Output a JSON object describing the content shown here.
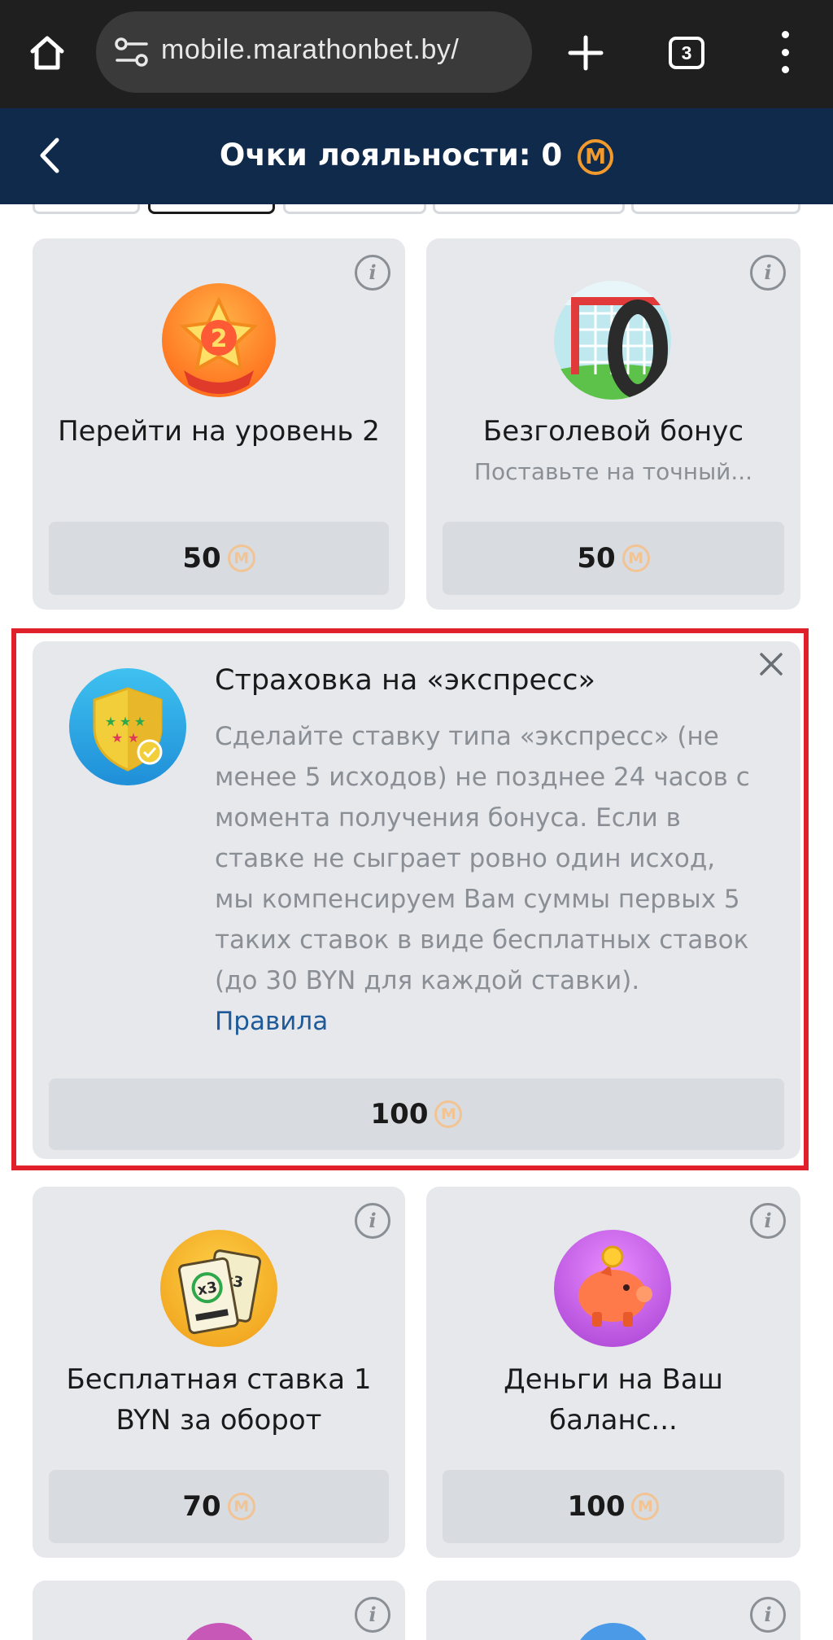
{
  "browser": {
    "url": "mobile.marathonbet.by/",
    "tab_count": "3"
  },
  "header": {
    "title": "Очки лояльности: 0",
    "coin_symbol": "М"
  },
  "coin_symbol": "М",
  "offers": [
    {
      "title": "Перейти на уровень 2",
      "subtitle": "",
      "price": "50",
      "icon": "level-2-star-medal-icon"
    },
    {
      "title": "Безголевой бонус",
      "subtitle": "Поставьте на точный...",
      "price": "50",
      "icon": "goal-zero-icon"
    }
  ],
  "featured": {
    "title": "Страховка на «экспресс»",
    "description": "Сделайте ставку типа «экспресс» (не менее 5 исходов) не позднее 24 часов с момента получения бонуса. Если в ставке не сыграет ровно один исход, мы компенсируем Вам суммы первых 5 таких ставок в виде бесплатных ставок (до 30 BYN для каждой ставки).",
    "rules_link": "Правила",
    "price": "100",
    "icon": "shield-stars-icon"
  },
  "offers_bottom": [
    {
      "title": "Бесплатная ставка 1 BYN за оборот",
      "price": "70",
      "icon": "free-bet-x3-icon"
    },
    {
      "title": "Деньги на Ваш баланс...",
      "price": "100",
      "icon": "piggy-bank-icon"
    }
  ],
  "colors": {
    "browser_bar": "#1f1f1f",
    "header_bg": "#0f2a4a",
    "card_bg": "#e6e8ec",
    "highlight_border": "#e0202a",
    "coin": "#f29a2e",
    "link": "#1e5a9a"
  }
}
